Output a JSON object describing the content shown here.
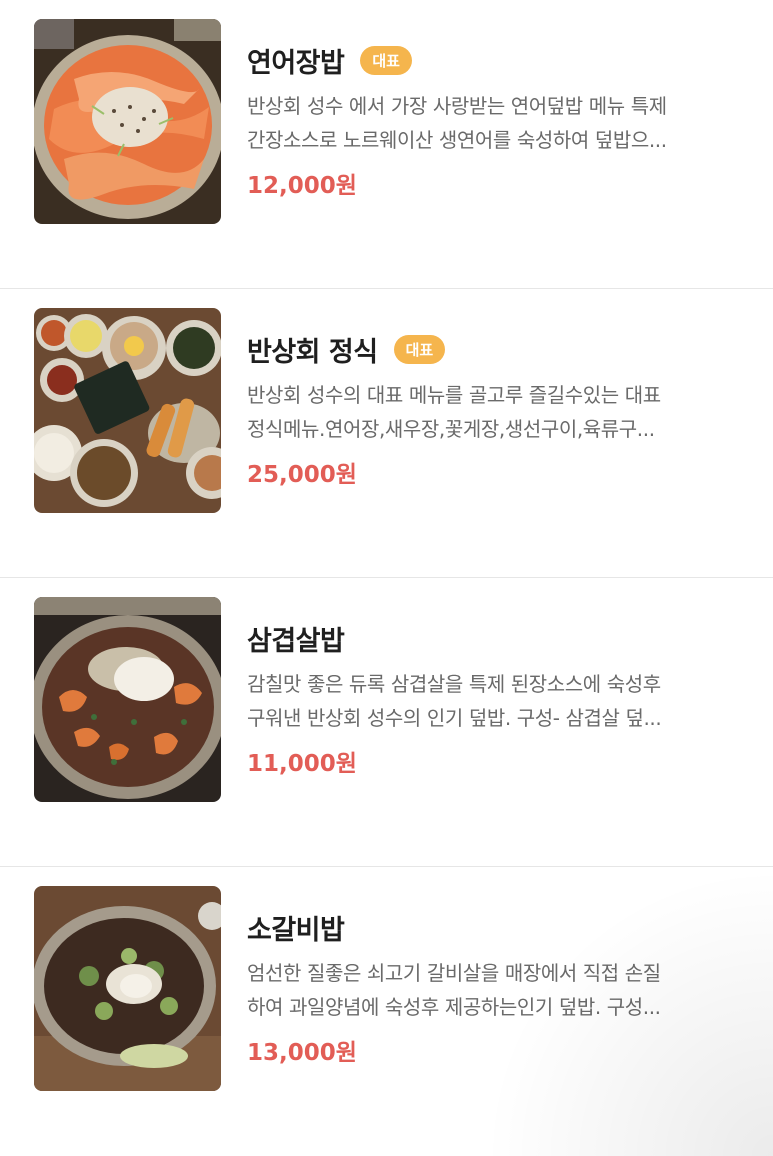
{
  "menu": {
    "items": [
      {
        "name": "연어장밥",
        "badge": "대표",
        "desc_line1": "반상회 성수 에서 가장 사랑받는 연어덮밥 메뉴 특제",
        "desc_line2": "간장소스로 노르웨이산 생연어를 숙성하여 덮밥으...",
        "price": "12,000원",
        "image": "salmon-rice-bowl-photo"
      },
      {
        "name": "반상회 정식",
        "badge": "대표",
        "desc_line1": "반상회 성수의 대표 메뉴를 골고루 즐길수있는 대표",
        "desc_line2": "정식메뉴.연어장,새우장,꽃게장,생선구이,육류구...",
        "price": "25,000원",
        "image": "set-meal-photo"
      },
      {
        "name": "삼겹살밥",
        "badge": "",
        "desc_line1": "감칠맛 좋은 듀록 삼겹살을 특제 된장소스에 숙성후",
        "desc_line2": "구워낸 반상회 성수의 인기 덮밥. 구성- 삼겹살 덮...",
        "price": "11,000원",
        "image": "pork-belly-rice-bowl-photo"
      },
      {
        "name": "소갈비밥",
        "badge": "",
        "desc_line1": "엄선한 질좋은 쇠고기 갈비살을 매장에서 직접 손질",
        "desc_line2": "하여 과일양념에 숙성후 제공하는인기 덮밥. 구성...",
        "price": "13,000원",
        "image": "beef-rib-rice-bowl-photo"
      }
    ]
  },
  "colors": {
    "price": "#e25d56",
    "badge_bg": "#f5b54d",
    "desc": "#6a6a6a"
  }
}
